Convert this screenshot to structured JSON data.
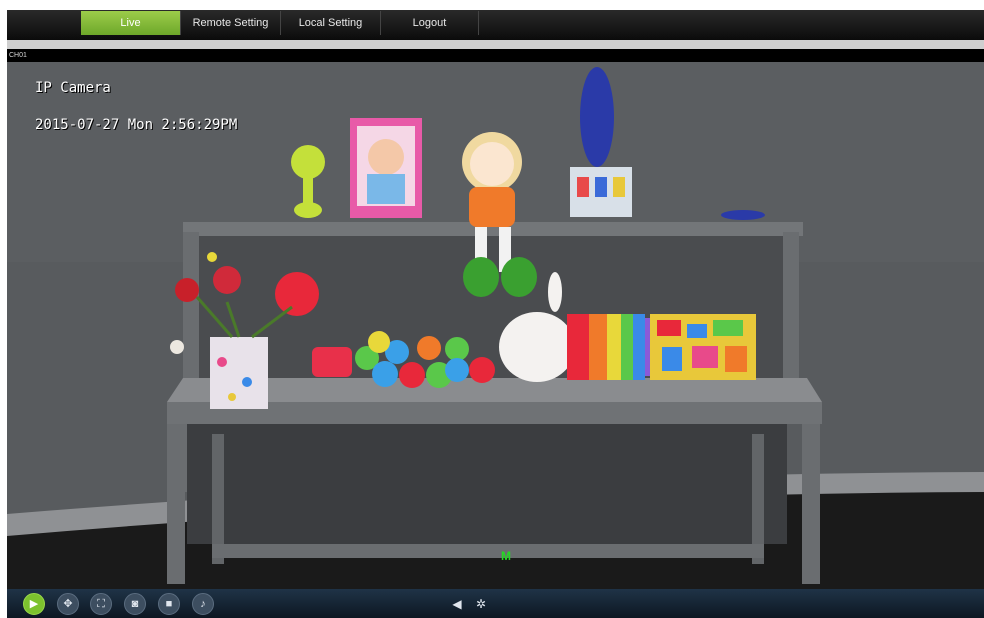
{
  "nav": {
    "tabs": [
      {
        "label": "Live",
        "active": true
      },
      {
        "label": "Remote Setting",
        "active": false
      },
      {
        "label": "Local Setting",
        "active": false
      },
      {
        "label": "Logout",
        "active": false
      }
    ]
  },
  "channel": {
    "label": "CH01"
  },
  "video": {
    "camera_name": "IP Camera",
    "timestamp": "2015-07-27 Mon 2:56:29PM",
    "motion_indicator": "M"
  },
  "toolbar": {
    "buttons": [
      {
        "icon": "live-view-icon",
        "active": true
      },
      {
        "icon": "ptz-control-icon",
        "active": false
      },
      {
        "icon": "fullscreen-icon",
        "active": false
      },
      {
        "icon": "snapshot-icon",
        "active": false
      },
      {
        "icon": "record-icon",
        "active": false
      },
      {
        "icon": "microphone-icon",
        "active": false
      }
    ],
    "volume_icon": "volume-icon",
    "settings_icon": "gear-icon"
  },
  "colors": {
    "active_tab": "#7dc22e",
    "motion_indicator": "#22dd22",
    "toolbar_bg": "#142231"
  }
}
